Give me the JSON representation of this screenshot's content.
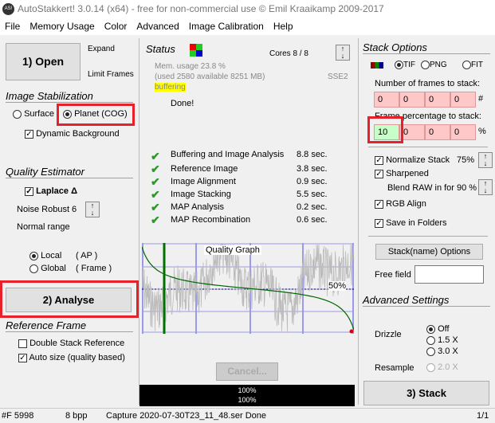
{
  "window": {
    "title": "AutoStakkert! 3.0.14 (x64) - free for non-commercial use © Emil Kraaikamp 2009-2017",
    "logo": "AS!"
  },
  "menu": [
    "File",
    "Memory Usage",
    "Color",
    "Advanced",
    "Image Calibration",
    "Help"
  ],
  "left": {
    "open_label": "1) Open",
    "expand": "Expand",
    "limit_frames": "Limit Frames",
    "stabilization_title": "Image Stabilization",
    "surface": "Surface",
    "planet": "Planet (COG)",
    "dynamic_bg": "Dynamic Background",
    "quality_title": "Quality Estimator",
    "laplace": "Laplace Δ",
    "noise_robust": "Noise Robust",
    "noise_value": "6",
    "normal_range": "Normal range",
    "local": "Local",
    "local_ap": "( AP )",
    "global": "Global",
    "global_frame": "( Frame )",
    "analyse_label": "2) Analyse",
    "reference_title": "Reference Frame",
    "double_stack": "Double Stack Reference",
    "auto_size": "Auto size (quality based)"
  },
  "status": {
    "title": "Status",
    "cores": "Cores 8 / 8",
    "mem1": "Mem. usage 23.8 %",
    "mem2": "(used 2580 available 8251 MB)",
    "sse": "SSE2",
    "buffering": "buffering",
    "done": "Done!",
    "steps": [
      {
        "label": "Buffering and Image Analysis",
        "time": "8.8 sec."
      },
      {
        "label": "Reference Image",
        "time": "3.8 sec."
      },
      {
        "label": "Image Alignment",
        "time": "0.9 sec."
      },
      {
        "label": "Image Stacking",
        "time": "5.5 sec."
      },
      {
        "label": "MAP Analysis",
        "time": "0.2 sec."
      },
      {
        "label": "MAP Recombination",
        "time": "0.6 sec."
      }
    ],
    "graph_title": "Quality Graph",
    "graph_pct": "50%",
    "cancel": "Cancel...",
    "progress1": "100%",
    "progress2": "100%"
  },
  "stack": {
    "title": "Stack Options",
    "tif": "TIF",
    "png": "PNG",
    "fit": "FIT",
    "num_frames_label": "Number of frames to stack:",
    "num_frames": [
      "0",
      "0",
      "0",
      "0"
    ],
    "hash": "#",
    "pct_label": "Frame percentage to stack:",
    "pct": [
      "10",
      "0",
      "0",
      "0"
    ],
    "pct_sign": "%",
    "normalize": "Normalize Stack",
    "normalize_val": "75%",
    "sharpened": "Sharpened",
    "blend": "Blend RAW in for 90 %",
    "rgb_align": "RGB Align",
    "save_folders": "Save in Folders",
    "stackname_btn": "Stack(name) Options",
    "free_field": "Free field",
    "advanced_title": "Advanced Settings",
    "drizzle": "Drizzle",
    "off": "Off",
    "x15": "1.5 X",
    "x30": "3.0 X",
    "resample": "Resample",
    "x20": "2.0 X",
    "stack_btn": "3) Stack"
  },
  "statusbar": {
    "frames": "#F 5998",
    "bpp": "8 bpp",
    "capture": "Capture 2020-07-30T23_11_48.ser  Done",
    "page": "1/1"
  }
}
